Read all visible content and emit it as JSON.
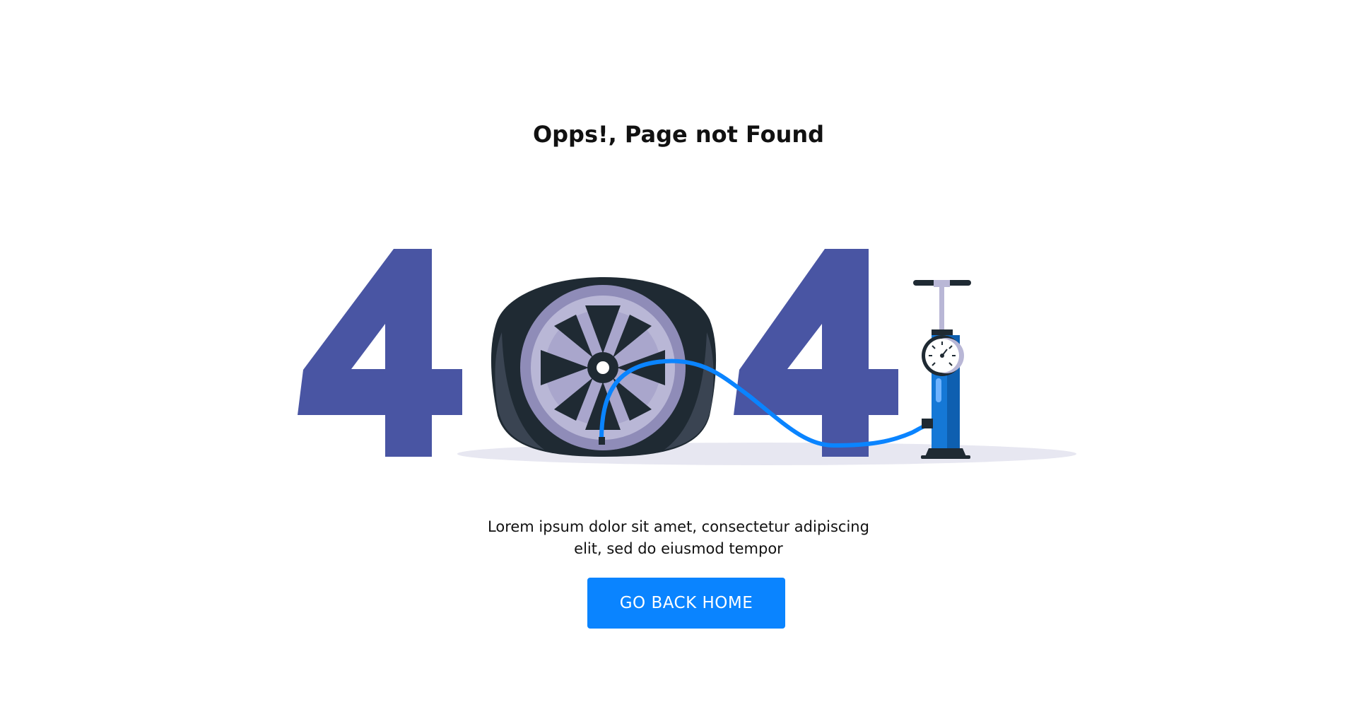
{
  "error_page": {
    "title": "Opps!, Page not Found",
    "message_line_1": "Lorem ipsum dolor sit amet, consectetur adipiscing",
    "message_line_2": "elit, sed do eiusmod tempor",
    "button_label": "GO BACK HOME"
  },
  "illustration": {
    "description_icons": [
      "digit-four-icon",
      "flat-tire-icon",
      "air-pump-icon",
      "pressure-gauge-icon",
      "air-hose-icon"
    ],
    "colors": {
      "digits": "#4955a3",
      "tire": "#1f2a33",
      "tire_shade": "#3a4452",
      "rim": "#b9b7d6",
      "rim_dark": "#8f8cb8",
      "hose": "#0a84ff",
      "pump": "#1578d6",
      "shadow": "#e7e7f1"
    }
  },
  "theme": {
    "accent": "#0a84ff",
    "text": "#111111",
    "background": "#ffffff"
  }
}
